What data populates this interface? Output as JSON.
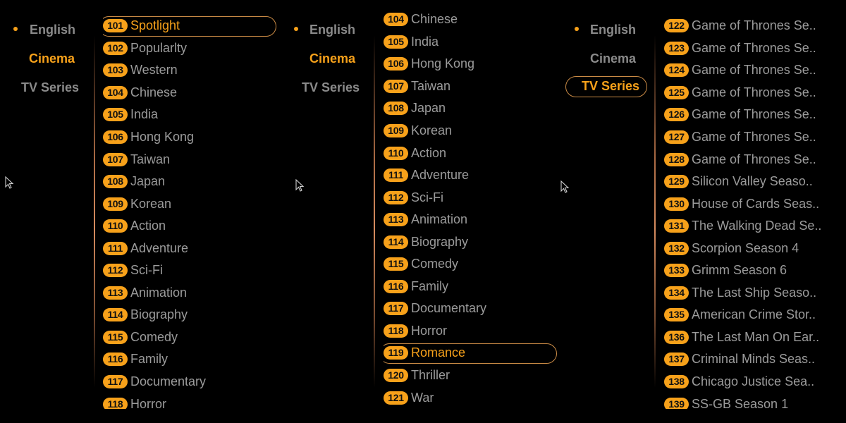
{
  "categories": {
    "language": "English",
    "cinema": "Cinema",
    "tv_series": "TV  Series"
  },
  "panels": [
    {
      "active_category": "Cinema",
      "focused_category": null,
      "selected_item": "101",
      "items": [
        {
          "num": "101",
          "label": "Spotlight"
        },
        {
          "num": "102",
          "label": "Popularlty"
        },
        {
          "num": "103",
          "label": "Western"
        },
        {
          "num": "104",
          "label": "Chinese"
        },
        {
          "num": "105",
          "label": "India"
        },
        {
          "num": "106",
          "label": "Hong Kong"
        },
        {
          "num": "107",
          "label": "Taiwan"
        },
        {
          "num": "108",
          "label": "Japan"
        },
        {
          "num": "109",
          "label": "Korean"
        },
        {
          "num": "110",
          "label": "Action"
        },
        {
          "num": "111",
          "label": "Adventure"
        },
        {
          "num": "112",
          "label": "Sci-Fi"
        },
        {
          "num": "113",
          "label": "Animation"
        },
        {
          "num": "114",
          "label": "Biography"
        },
        {
          "num": "115",
          "label": "Comedy"
        },
        {
          "num": "116",
          "label": "Family"
        },
        {
          "num": "117",
          "label": "Documentary"
        },
        {
          "num": "118",
          "label": "Horror"
        }
      ]
    },
    {
      "active_category": "Cinema",
      "focused_category": null,
      "selected_item": "119",
      "items": [
        {
          "num": "104",
          "label": "Chinese"
        },
        {
          "num": "105",
          "label": "India"
        },
        {
          "num": "106",
          "label": "Hong Kong"
        },
        {
          "num": "107",
          "label": "Taiwan"
        },
        {
          "num": "108",
          "label": "Japan"
        },
        {
          "num": "109",
          "label": "Korean"
        },
        {
          "num": "110",
          "label": "Action"
        },
        {
          "num": "111",
          "label": "Adventure"
        },
        {
          "num": "112",
          "label": "Sci-Fi"
        },
        {
          "num": "113",
          "label": "Animation"
        },
        {
          "num": "114",
          "label": "Biography"
        },
        {
          "num": "115",
          "label": "Comedy"
        },
        {
          "num": "116",
          "label": "Family"
        },
        {
          "num": "117",
          "label": "Documentary"
        },
        {
          "num": "118",
          "label": "Horror"
        },
        {
          "num": "119",
          "label": "Romance"
        },
        {
          "num": "120",
          "label": "Thriller"
        },
        {
          "num": "121",
          "label": "War"
        }
      ]
    },
    {
      "active_category": "TV  Series",
      "focused_category": "TV  Series",
      "selected_item": null,
      "items": [
        {
          "num": "122",
          "label": "Game of Thrones Se.."
        },
        {
          "num": "123",
          "label": "Game of Thrones Se.."
        },
        {
          "num": "124",
          "label": "Game of Thrones Se.."
        },
        {
          "num": "125",
          "label": "Game of Thrones Se.."
        },
        {
          "num": "126",
          "label": "Game of Thrones Se.."
        },
        {
          "num": "127",
          "label": "Game of Thrones Se.."
        },
        {
          "num": "128",
          "label": "Game of Thrones Se.."
        },
        {
          "num": "129",
          "label": "Silicon Valley Seaso.."
        },
        {
          "num": "130",
          "label": "House of Cards Seas.."
        },
        {
          "num": "131",
          "label": "The Walking Dead Se.."
        },
        {
          "num": "132",
          "label": "Scorpion Season 4"
        },
        {
          "num": "133",
          "label": "Grimm Season 6"
        },
        {
          "num": "134",
          "label": "The Last Ship Seaso.."
        },
        {
          "num": "135",
          "label": "American Crime Stor.."
        },
        {
          "num": "136",
          "label": "The Last Man On Ear.."
        },
        {
          "num": "137",
          "label": "Criminal Minds Seas.."
        },
        {
          "num": "138",
          "label": "Chicago Justice Sea.."
        },
        {
          "num": "139",
          "label": "SS-GB Season 1"
        }
      ]
    }
  ],
  "colors": {
    "accent": "#f7a11a",
    "text_muted": "#9b9b9b",
    "focus_border": "#c98a45",
    "background": "#000000"
  }
}
